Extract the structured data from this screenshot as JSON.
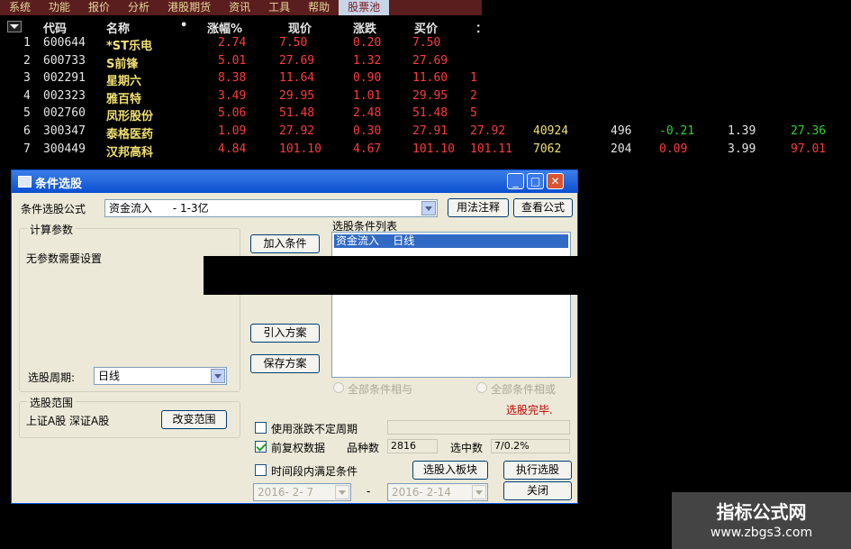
{
  "menubar": {
    "items": [
      "系统",
      "功能",
      "报价",
      "分析",
      "港股期货",
      "资讯",
      "工具",
      "帮助",
      "股票池"
    ],
    "active_index": 8
  },
  "table": {
    "headers": {
      "code": "代码",
      "name": "名称",
      "dot": "•",
      "change_pct": "涨幅%",
      "price": "现价",
      "change": "涨跌",
      "bid": "买价",
      "more": "："
    },
    "rows": [
      {
        "idx": "1",
        "code": "600644",
        "name": "*ST乐电",
        "change_pct": "2.74",
        "price": "7.50",
        "change": "0.20",
        "bid": "7.50",
        "ask": "",
        "vol": "",
        "cur": "",
        "rise": "",
        "turnover": "",
        "pe": ""
      },
      {
        "idx": "2",
        "code": "600733",
        "name": "S前锋",
        "change_pct": "5.01",
        "price": "27.69",
        "change": "1.32",
        "bid": "27.69",
        "ask": "",
        "vol": "",
        "cur": "",
        "rise": "",
        "turnover": "",
        "pe": ""
      },
      {
        "idx": "3",
        "code": "002291",
        "name": "星期六",
        "change_pct": "8.38",
        "price": "11.64",
        "change": "0.90",
        "bid": "11.60",
        "ask": "1",
        "vol": "",
        "cur": "",
        "rise": "",
        "turnover": "",
        "pe": ""
      },
      {
        "idx": "4",
        "code": "002323",
        "name": "雅百特",
        "change_pct": "3.49",
        "price": "29.95",
        "change": "1.01",
        "bid": "29.95",
        "ask": "2",
        "vol": "",
        "cur": "",
        "rise": "",
        "turnover": "",
        "pe": ""
      },
      {
        "idx": "5",
        "code": "002760",
        "name": "凤形股份",
        "change_pct": "5.06",
        "price": "51.48",
        "change": "2.48",
        "bid": "51.48",
        "ask": "5",
        "vol": "",
        "cur": "",
        "rise": "",
        "turnover": "",
        "pe": ""
      },
      {
        "idx": "6",
        "code": "300347",
        "name": "泰格医药",
        "change_pct": "1.09",
        "price": "27.92",
        "change": "0.30",
        "bid": "27.91",
        "ask": "27.92",
        "vol": "40924",
        "cur": "496",
        "rise": "-0.21",
        "turnover": "1.39",
        "pe": "27.36"
      },
      {
        "idx": "7",
        "code": "300449",
        "name": "汉邦高科",
        "change_pct": "4.84",
        "price": "101.10",
        "change": "4.67",
        "bid": "101.10",
        "ask": "101.11",
        "vol": "7062",
        "cur": "204",
        "rise": "0.09",
        "turnover": "3.99",
        "pe": "97.01"
      }
    ]
  },
  "dialog": {
    "title": "条件选股",
    "formula_label": "条件选股公式",
    "formula_value": "资金流入      - 1-3亿",
    "usage_button": "用法注释",
    "view_formula_button": "查看公式",
    "calc_group_title": "计算参数",
    "no_params_text": "无参数需要设置",
    "period_label": "选股周期:",
    "period_value": "日线",
    "scope_group_title": "选股范围",
    "scope_text": "上证A股  深证A股",
    "change_scope_button": "改变范围",
    "add_condition_button": "加入条件",
    "import_plan_button": "引入方案",
    "save_plan_button": "保存方案",
    "condition_list_title": "选股条件列表",
    "condition_list_items": [
      "资金流入    日线"
    ],
    "radio_and": "全部条件相与",
    "radio_or": "全部条件相或",
    "status_text": "选股完毕.",
    "use_uncertain_period": "使用涨跌不定周期",
    "pre_adjust": "前复权数据",
    "stock_count_label": "品种数",
    "stock_count_value": "2816",
    "selected_label": "选中数",
    "selected_value": "7/0.2%",
    "time_range_label": "时间段内满足条件",
    "to_block_button": "选股入板块",
    "execute_button": "执行选股",
    "date_from": "2016- 2- 7",
    "date_sep": "-",
    "date_to": "2016- 2-14",
    "close_button": "关闭"
  },
  "watermark": {
    "line1": "指标公式网",
    "line2": "www.zbgs3.com"
  },
  "colors": {
    "background": "#000000",
    "up_red": "#ff3b3b",
    "stock_name_yellow": "#f0e070",
    "down_green": "#30d030",
    "status_red": "#c00000",
    "selection_blue": "#316ac5",
    "titlebar_blue": "#0a4fd0"
  }
}
